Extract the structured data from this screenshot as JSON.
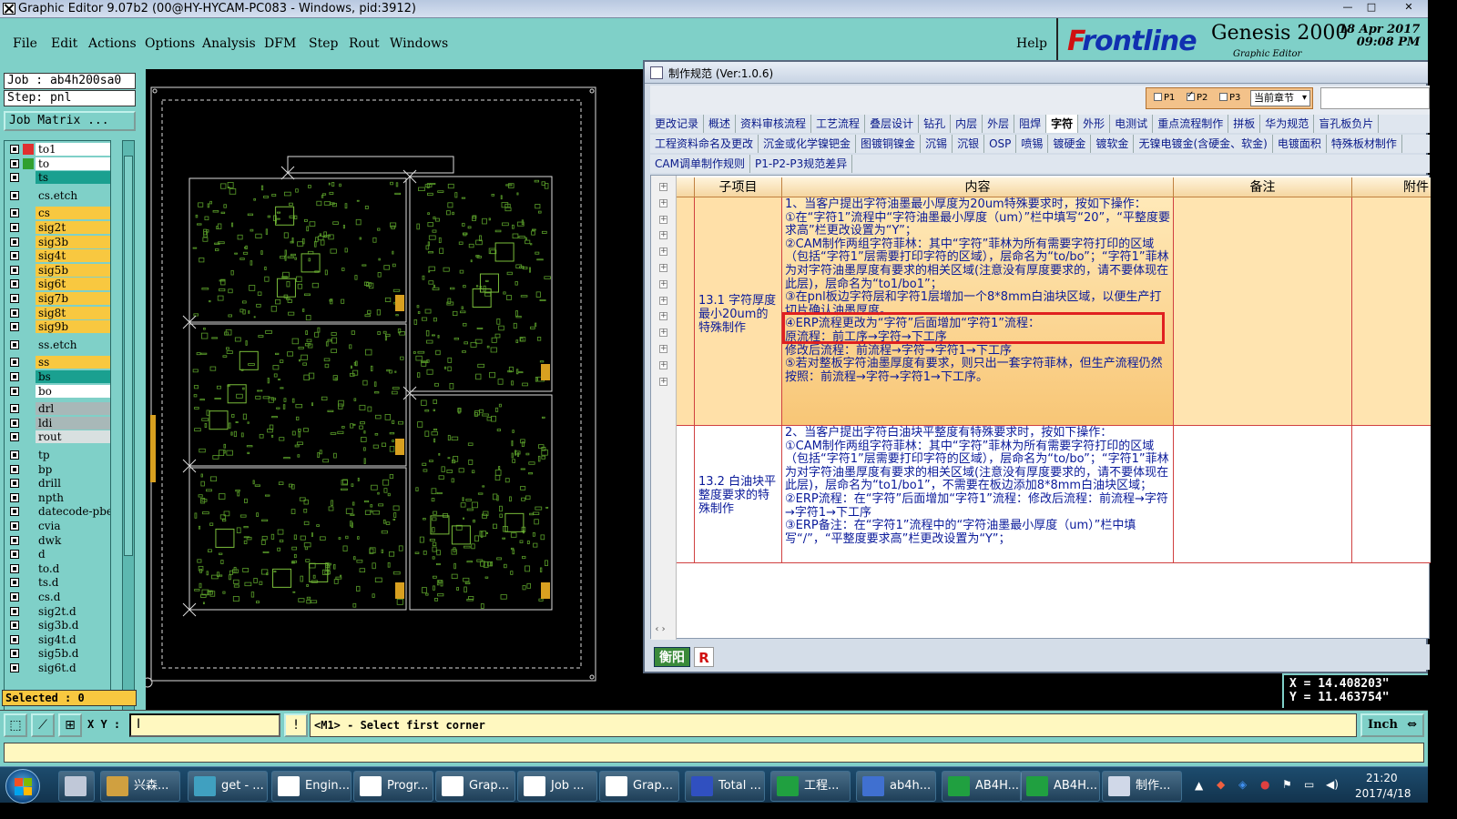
{
  "window": {
    "title": "Graphic Editor 9.07b2 (00@HY-HYCAM-PC083 - Windows, pid:3912)",
    "controls": [
      "—",
      "□",
      "✕"
    ]
  },
  "menu": [
    "File",
    "Edit",
    "Actions",
    "Options",
    "Analysis",
    "DFM",
    "Step",
    "Rout",
    "Windows"
  ],
  "help_label": "Help",
  "logo": {
    "brand_f": "F",
    "brand_rest": "rontline",
    "product": "Genesis 2000",
    "sub": "Graphic Editor",
    "date": "18 Apr 2017",
    "time": "09:08 PM"
  },
  "job": {
    "job_label": "Job : ab4h200sa0",
    "step_label": "Step: pnl",
    "matrix_button": "Job Matrix ..."
  },
  "layers": [
    {
      "name": "to1",
      "color": "#ffffff",
      "swatch": "#e03030"
    },
    {
      "name": "to",
      "color": "#ffffff",
      "swatch": "#30a030"
    },
    {
      "name": "ts",
      "color": "#1aa090",
      "swatch": ""
    },
    {
      "name": "cs.etch",
      "color": "#7fd0c8",
      "swatch": ""
    },
    {
      "name": "cs",
      "color": "#f8c840",
      "swatch": ""
    },
    {
      "name": "sig2t",
      "color": "#f8c840",
      "swatch": ""
    },
    {
      "name": "sig3b",
      "color": "#f8c840",
      "swatch": ""
    },
    {
      "name": "sig4t",
      "color": "#f8c840",
      "swatch": ""
    },
    {
      "name": "sig5b",
      "color": "#f8c840",
      "swatch": ""
    },
    {
      "name": "sig6t",
      "color": "#f8c840",
      "swatch": ""
    },
    {
      "name": "sig7b",
      "color": "#f8c840",
      "swatch": ""
    },
    {
      "name": "sig8t",
      "color": "#f8c840",
      "swatch": ""
    },
    {
      "name": "sig9b",
      "color": "#f8c840",
      "swatch": ""
    },
    {
      "name": "ss.etch",
      "color": "#7fd0c8",
      "swatch": ""
    },
    {
      "name": "ss",
      "color": "#f8c840",
      "swatch": ""
    },
    {
      "name": "bs",
      "color": "#1aa090",
      "swatch": ""
    },
    {
      "name": "bo",
      "color": "#ffffff",
      "swatch": ""
    },
    {
      "name": "drl",
      "color": "#a8b8b8",
      "swatch": ""
    },
    {
      "name": "ldi",
      "color": "#a8b8b8",
      "swatch": ""
    },
    {
      "name": "rout",
      "color": "#d8e0e0",
      "swatch": ""
    },
    {
      "name": "tp",
      "color": "#7fd0c8",
      "swatch": ""
    },
    {
      "name": "bp",
      "color": "#7fd0c8",
      "swatch": ""
    },
    {
      "name": "drill",
      "color": "#7fd0c8",
      "swatch": ""
    },
    {
      "name": "npth",
      "color": "#7fd0c8",
      "swatch": ""
    },
    {
      "name": "datecode-pbe",
      "color": "#7fd0c8",
      "swatch": ""
    },
    {
      "name": "cvia",
      "color": "#7fd0c8",
      "swatch": ""
    },
    {
      "name": "dwk",
      "color": "#7fd0c8",
      "swatch": ""
    },
    {
      "name": "d",
      "color": "#7fd0c8",
      "swatch": ""
    },
    {
      "name": "to.d",
      "color": "#7fd0c8",
      "swatch": ""
    },
    {
      "name": "ts.d",
      "color": "#7fd0c8",
      "swatch": ""
    },
    {
      "name": "cs.d",
      "color": "#7fd0c8",
      "swatch": ""
    },
    {
      "name": "sig2t.d",
      "color": "#7fd0c8",
      "swatch": ""
    },
    {
      "name": "sig3b.d",
      "color": "#7fd0c8",
      "swatch": ""
    },
    {
      "name": "sig4t.d",
      "color": "#7fd0c8",
      "swatch": ""
    },
    {
      "name": "sig5b.d",
      "color": "#7fd0c8",
      "swatch": ""
    },
    {
      "name": "sig6t.d",
      "color": "#7fd0c8",
      "swatch": ""
    }
  ],
  "selected_label": "Selected : 0",
  "status": {
    "xy_label": "X Y :",
    "message": "<M1> - Select first corner",
    "unit": "Inch"
  },
  "coords": {
    "x": "X = 14.408203\"",
    "y": "Y = 11.463754\""
  },
  "dialog": {
    "title": "制作规范 (Ver:1.0.6)",
    "p_options": [
      "P1",
      "P2",
      "P3"
    ],
    "p2_checked": true,
    "scope_select": "当前章节",
    "tabs_row1": [
      "更改记录",
      "概述",
      "资料审核流程",
      "工艺流程",
      "叠层设计",
      "钻孔",
      "内层",
      "外层",
      "阻焊",
      "字符",
      "外形",
      "电测试",
      "重点流程制作",
      "拼板",
      "华为规范",
      "盲孔板负片"
    ],
    "active_tab": "字符",
    "tabs_row2": [
      "工程资料命名及更改",
      "沉金或化学镍钯金",
      "图镀铜镍金",
      "沉锡",
      "沉银",
      "OSP",
      "喷锡",
      "镀硬金",
      "镀软金",
      "无镍电镀金(含硬金、软金)",
      "电镀面积",
      "特殊板材制作"
    ],
    "tabs_row3": [
      "CAM调单制作规则",
      "P1-P2-P3规范差异"
    ],
    "columns": [
      "子项目",
      "内容",
      "备注",
      "附件"
    ],
    "rows": [
      {
        "sub": "13.1 字符厚度最小20um的特殊制作",
        "content": "1、当客户提出字符油墨最小厚度为20um特殊要求时，按如下操作：\n①在“字符1”流程中“字符油墨最小厚度（um）”栏中填写“20”，“平整度要求高”栏更改设置为“Y”；\n②CAM制作两组字符菲林：其中“字符”菲林为所有需要字符打印的区域（包括“字符1”层需要打印字符的区域），层命名为“to/bo”；“字符1”菲林为对字符油墨厚度有要求的相关区域(注意没有厚度要求的，请不要体现在此层)，层命名为“to1/bo1”；\n③在pnl板边字符层和字符1层增加一个8*8mm白油块区域，以便生产打切片确认油墨厚度。\n④ERP流程更改为“字符”后面增加“字符1”流程：\n原流程：前工序→字符→下工序\n修改后流程：前流程→字符→字符1→下工序\n⑤若对整板字符油墨厚度有要求，则只出一套字符菲林，但生产流程仍然按照：前流程→字符→字符1→下工序。"
      },
      {
        "sub": "13.2 白油块平整度要求的特殊制作",
        "content": "2、当客户提出字符白油块平整度有特殊要求时，按如下操作：\n①CAM制作两组字符菲林：其中“字符”菲林为所有需要字符打印的区域（包括“字符1”层需要打印字符的区域），层命名为“to/bo”；“字符1”菲林为对字符油墨厚度有要求的相关区域(注意没有厚度要求的，请不要体现在此层)，层命名为“to1/bo1”，不需要在板边添加8*8mm白油块区域；\n②ERP流程：在“字符”后面增加“字符1”流程：修改后流程：前流程→字符→字符1→下工序\n③ERP备注：在“字符1”流程中的“字符油墨最小厚度（um）”栏中填写“/”，“平整度要求高”栏更改设置为“Y”；"
      }
    ],
    "footer_btn1": "衡阳",
    "footer_btn2": "R"
  },
  "taskbar": {
    "items": [
      {
        "label": "兴森...",
        "color": "#d0a040"
      },
      {
        "label": "get - ...",
        "color": "#40a0c0"
      },
      {
        "label": "Engin...",
        "color": "#ffffff"
      },
      {
        "label": "Progr...",
        "color": "#ffffff"
      },
      {
        "label": "Grap...",
        "color": "#ffffff"
      },
      {
        "label": "Job ...",
        "color": "#ffffff"
      },
      {
        "label": "Grap...",
        "color": "#ffffff"
      },
      {
        "label": "Total ...",
        "color": "#3050c0"
      },
      {
        "label": "工程...",
        "color": "#20a040"
      },
      {
        "label": "ab4h...",
        "color": "#4070d0"
      },
      {
        "label": "AB4H...",
        "color": "#20a040"
      },
      {
        "label": "AB4H...",
        "color": "#20a040"
      },
      {
        "label": "制作...",
        "color": "#d0d8e8"
      }
    ],
    "time": "21:20",
    "date": "2017/4/18"
  }
}
